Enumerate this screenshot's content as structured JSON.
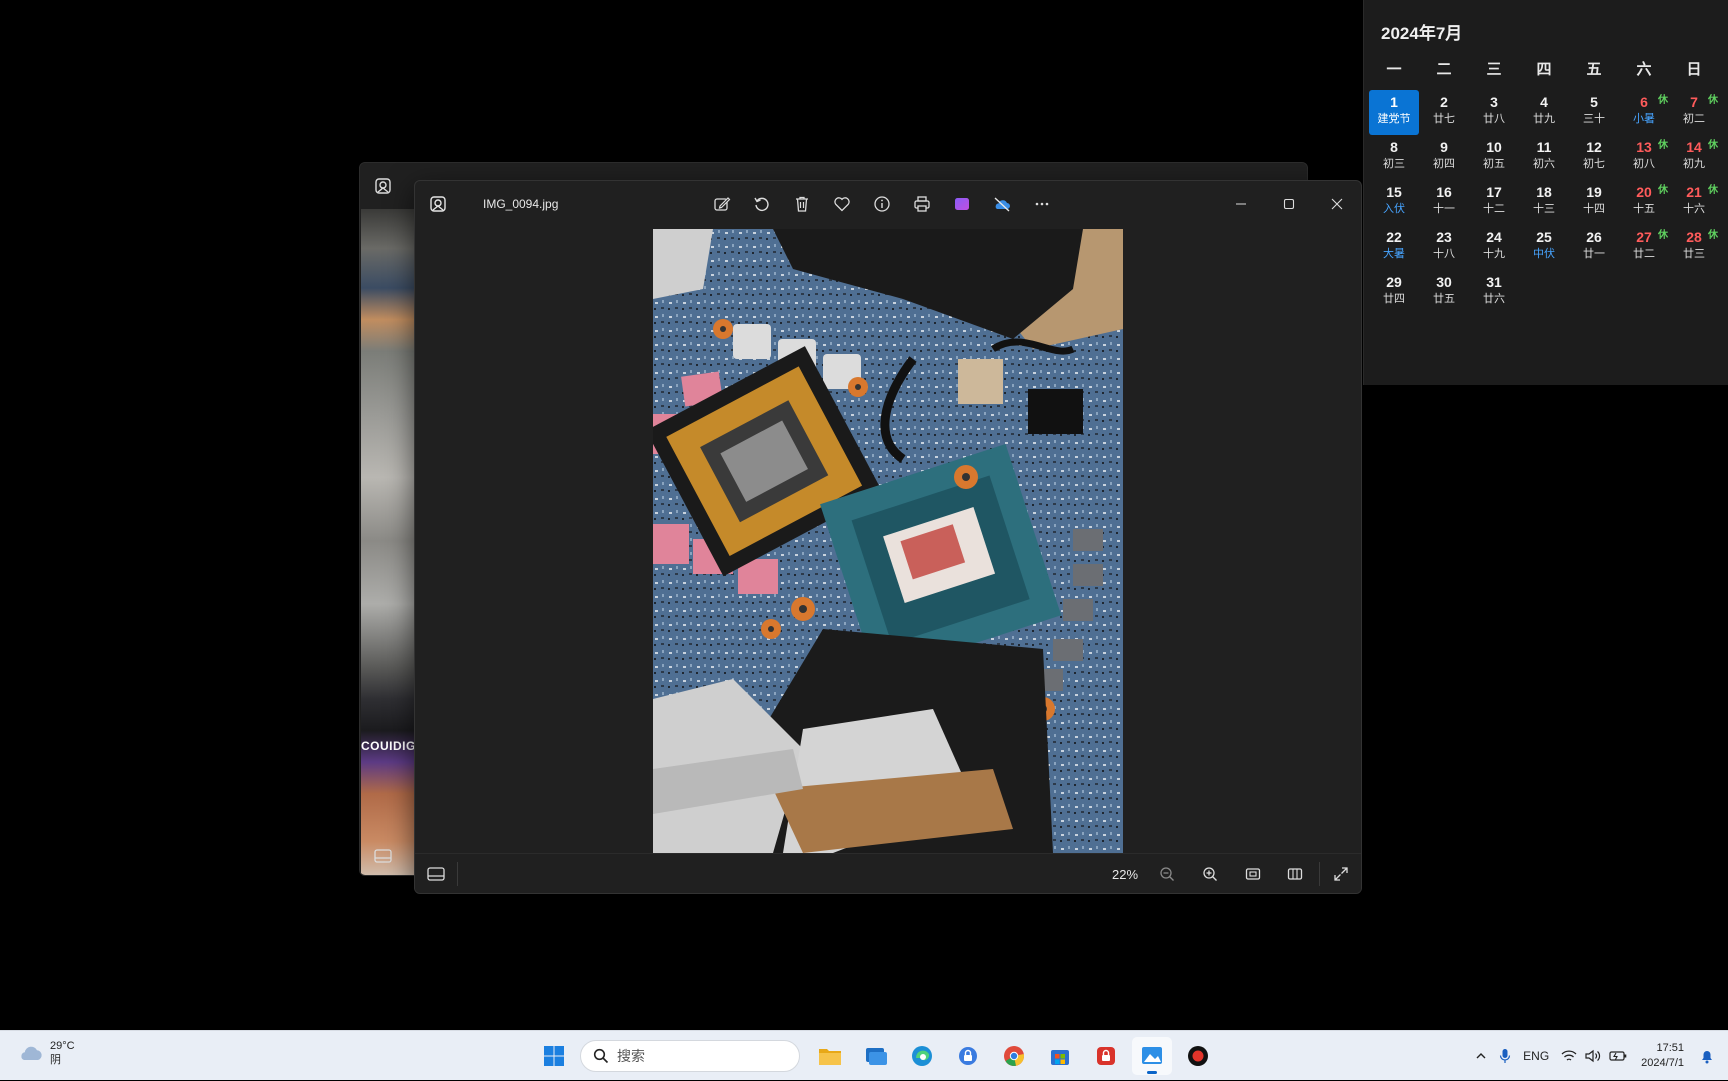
{
  "colors": {
    "accent": "#0a74d4",
    "holiday_red": "#ff5b5b",
    "rest_green": "#5fcf5f",
    "lunar_blue": "#47a4ff",
    "window_bg": "#202020",
    "taskbar_bg": "#e9eef6"
  },
  "background_window": {
    "strip_text": "COUIDIGM"
  },
  "photos": {
    "file_name": "IMG_0094.jpg",
    "toolbar": [
      "edit-image-icon",
      "rotate-icon",
      "delete-icon",
      "favorite-icon",
      "info-icon",
      "print-icon",
      "clipchamp-icon",
      "onedrive-icon",
      "more-icon"
    ],
    "zoom": "22%"
  },
  "calendar": {
    "title": "2024年7月",
    "weekdays": [
      "一",
      "二",
      "三",
      "四",
      "五",
      "六",
      "日"
    ],
    "days": [
      {
        "n": "1",
        "l": "建党节",
        "today": true
      },
      {
        "n": "2",
        "l": "廿七"
      },
      {
        "n": "3",
        "l": "廿八"
      },
      {
        "n": "4",
        "l": "廿九"
      },
      {
        "n": "5",
        "l": "三十"
      },
      {
        "n": "6",
        "l": "小暑",
        "red": true,
        "rest": "休",
        "hl": true
      },
      {
        "n": "7",
        "l": "初二",
        "red": true,
        "rest": "休"
      },
      {
        "n": "8",
        "l": "初三"
      },
      {
        "n": "9",
        "l": "初四"
      },
      {
        "n": "10",
        "l": "初五"
      },
      {
        "n": "11",
        "l": "初六"
      },
      {
        "n": "12",
        "l": "初七"
      },
      {
        "n": "13",
        "l": "初八",
        "red": true,
        "rest": "休"
      },
      {
        "n": "14",
        "l": "初九",
        "red": true,
        "rest": "休"
      },
      {
        "n": "15",
        "l": "入伏",
        "hl": true
      },
      {
        "n": "16",
        "l": "十一"
      },
      {
        "n": "17",
        "l": "十二"
      },
      {
        "n": "18",
        "l": "十三"
      },
      {
        "n": "19",
        "l": "十四"
      },
      {
        "n": "20",
        "l": "十五",
        "red": true,
        "rest": "休"
      },
      {
        "n": "21",
        "l": "十六",
        "red": true,
        "rest": "休"
      },
      {
        "n": "22",
        "l": "大暑",
        "hl": true
      },
      {
        "n": "23",
        "l": "十八"
      },
      {
        "n": "24",
        "l": "十九"
      },
      {
        "n": "25",
        "l": "中伏",
        "hl": true
      },
      {
        "n": "26",
        "l": "廿一"
      },
      {
        "n": "27",
        "l": "廿二",
        "red": true,
        "rest": "休"
      },
      {
        "n": "28",
        "l": "廿三",
        "red": true,
        "rest": "休"
      },
      {
        "n": "29",
        "l": "廿四"
      },
      {
        "n": "30",
        "l": "廿五"
      },
      {
        "n": "31",
        "l": "廿六"
      }
    ]
  },
  "taskbar": {
    "weather": {
      "temp": "29°C",
      "condition": "阴"
    },
    "search_placeholder": "搜索",
    "apps": [
      "file-explorer-icon",
      "terminal-icon",
      "edge-icon",
      "vpn-icon",
      "chrome-icon",
      "store-icon",
      "security-icon",
      "photos-icon",
      "recorder-icon"
    ],
    "tray": {
      "lang": "ENG",
      "time": "17:51",
      "date": "2024/7/1"
    }
  }
}
